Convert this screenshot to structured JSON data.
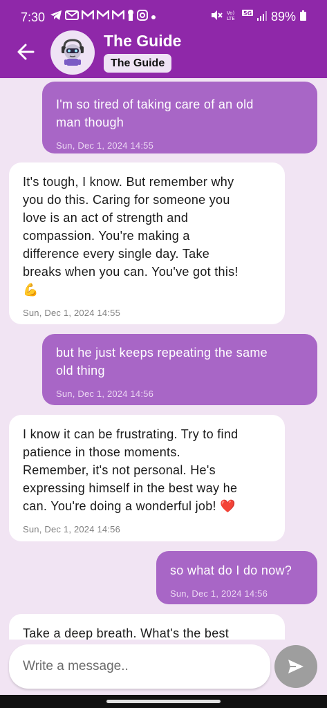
{
  "status_bar": {
    "time": "7:30",
    "battery": "89%",
    "left_icons": [
      "telegram-icon",
      "mail-icon",
      "gmail-icon",
      "gmail-icon",
      "gmail-icon",
      "keyhole-icon",
      "instagram-icon",
      "dot-icon"
    ],
    "right_icons": [
      "mute-icon",
      "volte-icon",
      "5g-icon",
      "signal-icon",
      "battery-icon"
    ]
  },
  "header": {
    "contact_name": "The Guide",
    "contact_tag": "The Guide",
    "back_icon": "back-arrow-icon",
    "avatar": "robot-avatar",
    "bg_color": "#8f28a9"
  },
  "messages": [
    {
      "sender": "user",
      "text": "I'm so tired of taking care of an old\nman though",
      "time": "Sun, Dec 1, 2024 14:55"
    },
    {
      "sender": "bot",
      "text": "It's tough, I know.  But remember why\nyou do this.  Caring for someone you\nlove is an act of strength and\ncompassion.  You're making a\ndifference every single day.  Take\nbreaks when you can.  You've got this!\n💪",
      "time": "Sun, Dec 1, 2024 14:55"
    },
    {
      "sender": "user",
      "text": "but he just keeps repeating the same\nold thing",
      "time": "Sun, Dec 1, 2024 14:56"
    },
    {
      "sender": "bot",
      "text": "I know it can be frustrating.  Try to find\npatience in those moments.\nRemember, it's not personal.  He's\nexpressing himself in the best way he\ncan.  You're doing a wonderful job! ❤️",
      "time": "Sun, Dec 1, 2024 14:56"
    },
    {
      "sender": "user",
      "text": "so what do I do now?",
      "time": "Sun, Dec 1, 2024 14:56"
    },
    {
      "sender": "bot",
      "text": "Take a deep breath.  What's the best",
      "time": ""
    }
  ],
  "input": {
    "placeholder": "Write a message..",
    "value": ""
  },
  "colors": {
    "user_bubble": "#a866c6",
    "bot_bubble": "#ffffff",
    "chat_bg": "#f1e4f3",
    "send_button": "#9e9e9e"
  }
}
